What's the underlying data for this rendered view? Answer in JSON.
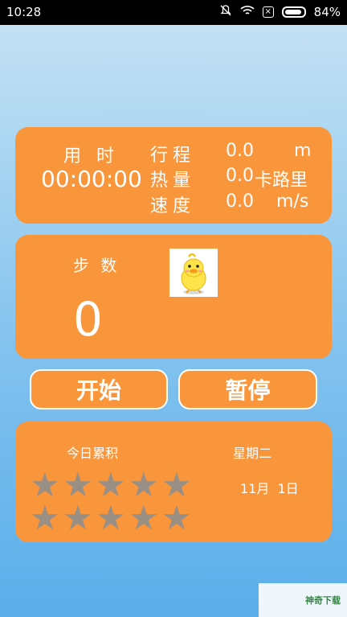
{
  "status_bar": {
    "time": "10:28",
    "battery": "84%"
  },
  "stats": {
    "time_label": "用 时",
    "time_value": "00:00:00",
    "distance_label": "行程",
    "distance_value": "0.0",
    "distance_unit": "m",
    "calorie_label": "热量",
    "calorie_value": "0.0",
    "calorie_unit": "卡路里",
    "speed_label": "速度",
    "speed_value": "0.0",
    "speed_unit": "m/s"
  },
  "steps": {
    "label": "步 数",
    "value": "0"
  },
  "buttons": {
    "start": "开始",
    "pause": "暂停"
  },
  "daily": {
    "label": "今日累积",
    "weekday": "星期二",
    "date": "11月  1日",
    "stars_earned": 0,
    "stars_total": 10
  },
  "colors": {
    "card": "#f9953b",
    "star_empty": "#9a8f84"
  },
  "watermark": "神奇下载"
}
